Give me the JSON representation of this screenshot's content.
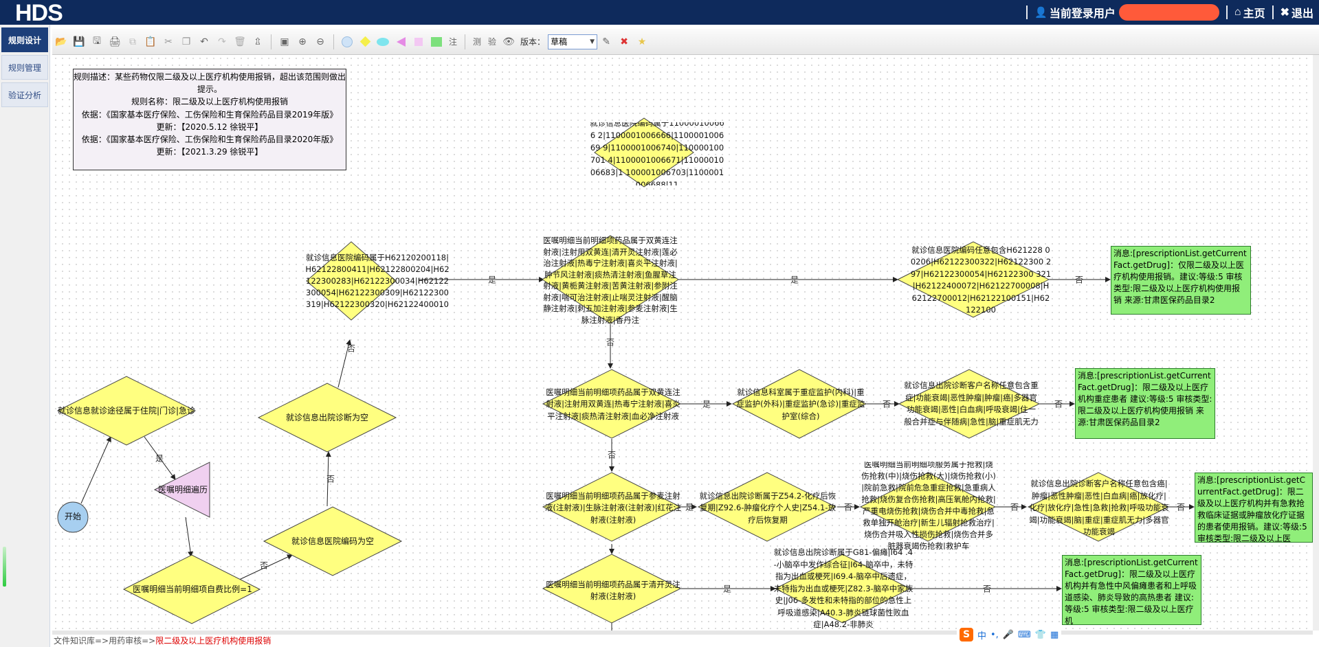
{
  "header": {
    "logo": "HDS",
    "user_label": "当前登录用户",
    "home_label": "主页",
    "logout_label": "退出"
  },
  "sidebar": {
    "items": [
      {
        "label": "规则设计",
        "active": true
      },
      {
        "label": "规则管理",
        "active": false
      },
      {
        "label": "验证分析",
        "active": false
      }
    ]
  },
  "toolbar": {
    "text_buttons": [
      "注",
      "测",
      "验"
    ],
    "version_label": "版本：",
    "version_value": "草稿"
  },
  "info": {
    "description": "规则描述：某些药物仅限二级及以上医疗机构使用报销，超出该范围则做出提示。",
    "name": "规则名称：限二级及以上医疗机构使用报销",
    "basis1": "依据：《国家基本医疗保险、工伤保险和生育保险药品目录2019年版》",
    "update1": "更新：【2020.5.12 徐锐平】",
    "basis2": "依据：《国家基本医疗保险、工伤保险和生育保险药品目录2020年版》",
    "update2": "更新：【2021.3.29 徐锐平】"
  },
  "nodes": {
    "start": "开始",
    "visit_path": "就诊信息就诊途径属于住院|门诊|急诊",
    "traverse": "医嘱明细遍历",
    "self_pay": "医嘱明细当前明细项自费比例=1",
    "hosp_code_empty": "就诊信息医院编码为空",
    "discharge_empty": "就诊信息出院诊断为空",
    "hosp_code_in": "就诊信息医院编码属于H62120200118|H62122800411|H62122800204|H62122300283|H62122300034|H62122300054|H62122300309|H62122300319|H62122300320|H62122400010",
    "hosp_code_top": "就诊信息医院编码属于110000100666 2|1100001006666|110000100669 9|1100001006740|110000100701 4|1100001006671|1100001006683|1 100001006703|1100001006688|11",
    "drug1": "医嘱明细当前明细项药品属于双黄连注射液|注射用双黄连|清开灵注射液|莲必治注射液|热毒宁注射液|喜炎平注射液|肿节风注射液|痰热清注射液|鱼腥草注射液|黄栀黄注射液|苦黄注射液|参附注射液|喘可治注射液|止喘灵注射液|醒脑静注射液|刺五加注射液|参麦注射液|生脉注射液|香丹注",
    "hosp_code_any": "就诊信息医院编码任意包含H621228 00206|H62122300322|H62122300 297|H62122300054|H62122300 321|H62122400072|H62122700008|H 62122700012|H62122100151|H62 122100",
    "drug2": "医嘱明细当前明细项药品属于双黄连注射液|注射用双黄连|热毒宁注射液|喜炎平注射液|痰热清注射液|血必净注射液",
    "dept": "就诊信息科室属于重症监护(内科)|重症监护(外科)|重症监护(急诊)|重症监护室(综合)",
    "diag1": "就诊信息出院诊断客户名称任意包含重症|功能衰竭|恶性肿瘤|肿瘤|癌|多器官功能衰竭|恶性|白血病|呼吸衰竭|住一般合并症与伴随病|急性|脑|重症肌无力",
    "drug3": "医嘱明细当前明细项药品属于参麦注射液(注射液)|生脉注射液(注射液)|红花注射液(注射液)",
    "diag2": "就诊信息出院诊断属于Z54.2-化疗后恢复期|Z92.6-肿瘤化疗个人史|Z54.1-放疗后恢复期",
    "service": "医嘱明细当前明细项服务属于抢救|烧伤抢救(中)|烧伤抢救(大)|烧伤抢救(小)|院前急救|院前危急重症抢救|急重病人抢救|烧伤复合伤抢救|高压氧舱内抢救|严重电烧伤抢救|烧伤合并中毒抢救|急救单独开舱治疗|新生儿辐射抢救治疗|烧伤合并吸入性损伤抢救|烧伤合并多脏器衰竭伤抢救|救护车",
    "diag3": "就诊信息出院诊断客户名称任意包含癌|肿瘤|恶性肿瘤|恶性|白血病|癌|放化疗|化疗|放化疗|急性|急救|抢救|呼吸功能衰竭|功能衰竭|脑|重症|重症肌无力|多器官功能衰竭",
    "drug4": "医嘱明细当前明细项药品属于清开灵注射液(注射液)",
    "diag4": "就诊信息出院诊断属于G81-偏瘫|I64 .4-小脑卒中发作综合征|I64-脑卒中，未特指为出血或梗死|I69.4-脑卒中后遗症，未特指为出血或梗死|Z82.3-脑卒中家族史|J06-多发性和未特指的部位的急性上呼吸道感染|A40.3-肺炎链球菌性败血症|A48.2-非肺炎"
  },
  "messages": {
    "m1": "消息:[prescriptionList.getCurrentFact.getDrug]：仅限二级及以上医疗机构使用报销。建议:等级:5 审核类型:限二级及以上医疗机构使用报销 来源:甘肃医保药品目录2",
    "m2": "消息:[prescriptionList.getCurrentFact.getDrug]：限二级及以上医疗机构重症患者 建议:等级:5 审核类型:限二级及以上医疗机构使用报销 来源:甘肃医保药品目录2",
    "m3": "消息:[prescriptionList.getCurrentFact.getDrug]：限二级及以上医疗机构并有急救抢救临床证据或肿瘤放化疗证据的患者使用报销。建议:等级:5 审核类型:限二级及以上医",
    "m4": "消息:[prescriptionList.getCurrentFact.getDrug]：限二级及以上医疗机构并有急性中风偏瘫患者和上呼吸道感染、肺炎导致的高热患者 建议:等级:5 审核类型:限二级及以上医疗机"
  },
  "edge_labels": {
    "yes": "是",
    "no": "否"
  },
  "status": {
    "path": "文件知识库=>用药审核=>",
    "current": "限二级及以上医疗机构使用报销"
  },
  "ime": {
    "logo": "S",
    "lang": "中"
  },
  "colors": {
    "header_bg": "#0e2a5c",
    "diamond_fill": "#ffff80",
    "message_fill": "#90ee7a",
    "start_fill": "#a7cff0",
    "traverse_fill": "#f0d0f0",
    "status_current": "#dd0000"
  }
}
